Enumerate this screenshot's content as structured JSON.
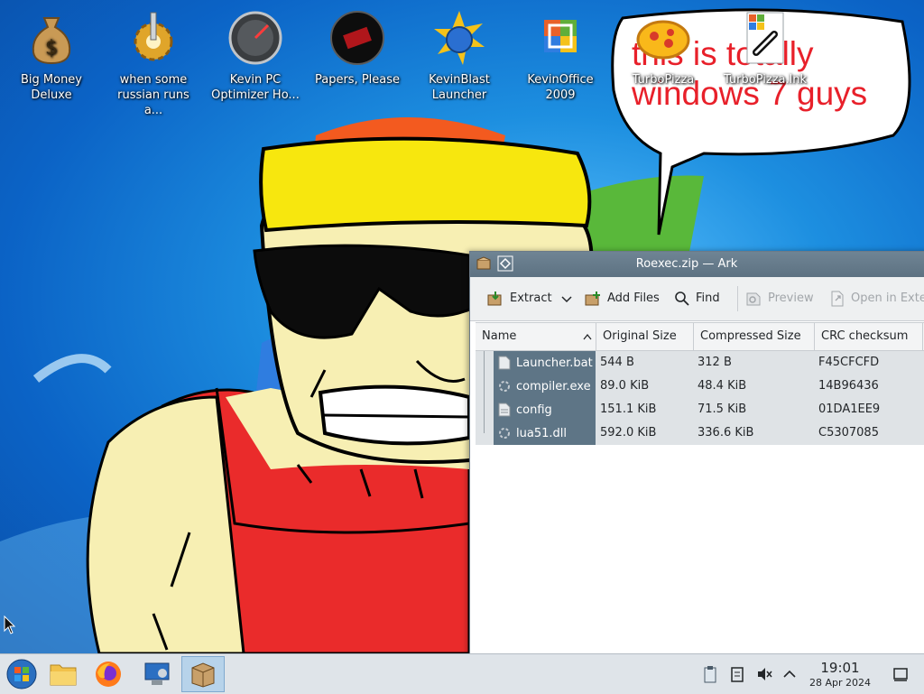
{
  "wallpaper": {
    "caption": "this is totally windows 7 guys"
  },
  "desktop_icons": [
    {
      "label": "Big Money Deluxe",
      "icon": "money-bag-icon"
    },
    {
      "label": "when some russian runs a...",
      "icon": "gear-icon"
    },
    {
      "label": "Kevin PC Optimizer Ho...",
      "icon": "speedometer-icon"
    },
    {
      "label": "Papers, Please",
      "icon": "papers-please-icon"
    },
    {
      "label": "KevinBlast Launcher",
      "icon": "globe-launcher-icon"
    },
    {
      "label": "KevinOffice 2009",
      "icon": "office-icon"
    },
    {
      "label": "TurboPizza",
      "icon": "pizza-icon"
    },
    {
      "label": "TurboPizza.lnk",
      "icon": "shortcut-icon"
    }
  ],
  "ark": {
    "title": "Roexec.zip — Ark",
    "toolbar": {
      "extract": "Extract",
      "add_files": "Add Files",
      "find": "Find",
      "preview": "Preview",
      "open_in_external": "Open in Exter"
    },
    "columns": [
      "Name",
      "Original Size",
      "Compressed Size",
      "CRC checksum"
    ],
    "rows": [
      {
        "name": "Launcher.bat",
        "original": "544 B",
        "compressed": "312 B",
        "crc": "F45CFCFD",
        "icon": "script-file-icon"
      },
      {
        "name": "compiler.exe",
        "original": "89.0 KiB",
        "compressed": "48.4 KiB",
        "crc": "14B96436",
        "icon": "executable-file-icon"
      },
      {
        "name": "config",
        "original": "151.1 KiB",
        "compressed": "71.5 KiB",
        "crc": "01DA1EE9",
        "icon": "text-file-icon"
      },
      {
        "name": "lua51.dll",
        "original": "592.0 KiB",
        "compressed": "336.6 KiB",
        "crc": "C5307085",
        "icon": "library-file-icon"
      }
    ]
  },
  "taskbar": {
    "apps": [
      "start-menu-icon",
      "file-manager-icon",
      "firefox-icon",
      "system-settings-icon",
      "ark-icon"
    ],
    "clock_time": "19:01",
    "clock_date": "28 Apr 2024",
    "tray": [
      "clipboard-icon",
      "notes-icon",
      "volume-muted-icon",
      "chevron-up-icon",
      "show-desktop-icon"
    ]
  },
  "colors": {
    "selection": "#5e7586",
    "caption_red": "#e8202a",
    "title_bar": "#6f8494"
  }
}
